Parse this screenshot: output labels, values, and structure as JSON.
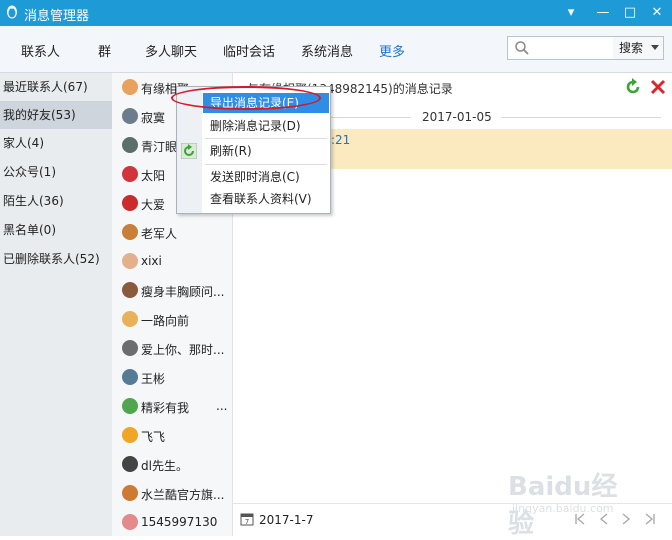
{
  "window": {
    "title": "消息管理器",
    "minimize": "▾",
    "restore": "—",
    "maximize": "□",
    "close": "✕"
  },
  "menu": [
    {
      "label": "联系人"
    },
    {
      "label": "群"
    },
    {
      "label": "多人聊天"
    },
    {
      "label": "临时会话"
    },
    {
      "label": "系统消息"
    },
    {
      "label": "更多"
    }
  ],
  "search": {
    "placeholder": "",
    "button_label": "搜索"
  },
  "leftnav": [
    "最近联系人(67)",
    "我的好友(53)",
    "家人(4)",
    "公众号(1)",
    "陌生人(36)",
    "黑名单(0)",
    "已删除联系人(52)"
  ],
  "contacts": [
    {
      "name": "有缘相聚",
      "color": "#e9a25e"
    },
    {
      "name": "寂寞",
      "color": "#6b7d8c"
    },
    {
      "name": "青汀眼",
      "color": "#5b6f6a"
    },
    {
      "name": "太阳",
      "color": "#d1343a"
    },
    {
      "name": "大爱",
      "color": "#cc2b2b"
    },
    {
      "name": "老军人",
      "color": "#c87f3a"
    },
    {
      "name": "xixi",
      "color": "#e3b08b"
    },
    {
      "name": "瘦身丰胸顾问...",
      "color": "#8a5a3c"
    },
    {
      "name": "一路向前",
      "color": "#e8b25a"
    },
    {
      "name": "爱上你、那时...",
      "color": "#6d6d6d"
    },
    {
      "name": "王彬",
      "color": "#567b95"
    },
    {
      "name": "精彩有我",
      "color": "#4fa64f",
      "suffix": "..."
    },
    {
      "name": "飞飞",
      "color": "#f0a525"
    },
    {
      "name": "dl先生。",
      "color": "#444"
    },
    {
      "name": "水兰酷官方旗...",
      "color": "#cf7a33"
    },
    {
      "name": "1545997130",
      "color": "#e48a8a"
    }
  ],
  "main": {
    "header_title": "与有缘相聚(1348982145)的消息记录",
    "date_divider": "2017-01-05",
    "message_time": ":21",
    "footer_date": "2017-1-7"
  },
  "context_menu": [
    {
      "label": "导出消息记录(E)"
    },
    {
      "label": "删除消息记录(D)"
    },
    {
      "label": "刷新(R)"
    },
    {
      "label": "发送即时消息(C)"
    },
    {
      "label": "查看联系人资料(V)"
    }
  ],
  "watermark": {
    "brand": "Baidu经验",
    "sub": "jingyan.baidu.com"
  },
  "colors": {
    "titlebar": "#1e9ad6",
    "highlight": "#2e8ee5",
    "annotation": "#d6192a",
    "message_strip": "#fbe9bf"
  }
}
